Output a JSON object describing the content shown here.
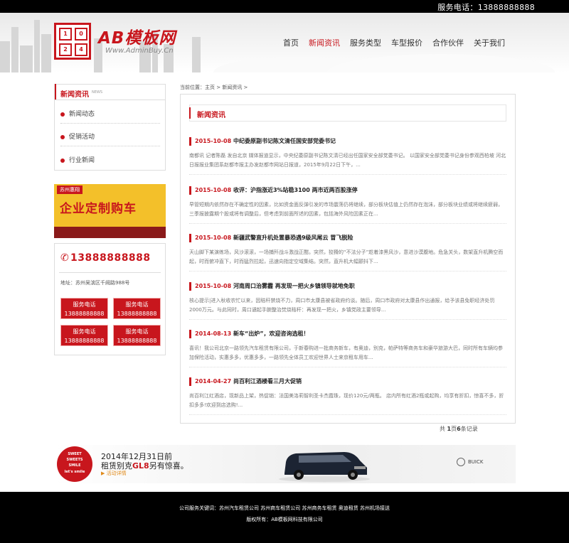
{
  "topbar": {
    "phone": "服务电话：13888888888"
  },
  "header": {
    "logo_cells": [
      "1",
      "0",
      "2",
      "4"
    ],
    "logo_title": "AB模板网",
    "logo_url": "Www.AdminBuy.Cn",
    "nav": [
      {
        "label": "首页",
        "active": false
      },
      {
        "label": "新闻资讯",
        "active": true
      },
      {
        "label": "服务类型",
        "active": false
      },
      {
        "label": "车型报价",
        "active": false
      },
      {
        "label": "合作伙伴",
        "active": false
      },
      {
        "label": "关于我们",
        "active": false
      }
    ]
  },
  "sidebar": {
    "title": "新闻资讯",
    "subtitle": "NEWS",
    "items": [
      "新闻动态",
      "促销活动",
      "行业新闻"
    ],
    "promo": {
      "tag": "苏州惠翔",
      "text": "企业定制购车"
    },
    "phone": "13888888888",
    "address": "地址：苏州吴滨区千阙路988号",
    "service_buttons": [
      {
        "label": "服务电话",
        "number": "13888888888"
      },
      {
        "label": "服务电话",
        "number": "13888888888"
      },
      {
        "label": "服务电话",
        "number": "13888888888"
      },
      {
        "label": "服务电话",
        "number": "13888888888"
      }
    ]
  },
  "breadcrumb": "当前位置：主页 > 新闻资讯 >",
  "main": {
    "title": "新闻资讯",
    "articles": [
      {
        "date": "2015-10-08",
        "title": "中纪委原副书记陈文清任国安部党委书记",
        "summary": "南都讯 记者陈磊 发自北京 媒体报道显示，中央纪委原副书记陈文清已经出任国家安全部党委书记。 以国家安全部党委书记身份参观西柏坡 河北日报报业集团系赵都市报主办发赵都市网站日报道，2015年9月22日下午，..."
      },
      {
        "date": "2015-10-08",
        "title": "收评：沪指涨近3%站稳3100 两市近两百股涨停",
        "summary": "早管短期内依然存在不确定性的因素，比如资金面反弹引发的市场震荡仍将继续，部分板块估值上仍然存在泡沫，部分板块业绩或将继续疲弱，三季报披露期个股或将有调整后，但考虑到前面所述的因素，包括海外风险因素正在..."
      },
      {
        "date": "2015-10-08",
        "title": "新疆武警直升机处置暴恐遇9级风尾云 冒飞脱险",
        "summary": "天山脚下某演练场，风沙滚滚，一场捕歼战斗激战正酣。突然，狡猾的“不法分子”趁着漆黑风沙，意进沙漠腹地。危急关头，数架直升机腾空而起，时而俯冲直下，时而猛烈拉起，迅速向指定空域集结。突然，直升机大幅颤抖下..."
      },
      {
        "date": "2015-10-08",
        "title": "河南周口治雾霾 再发现一把火乡镇领导就地免职",
        "summary": "核心提示|进入秋收农忙以来，因秸秆禁烧不力，周口市太康县被省政府约谈。随后，周口市政府对太康县作出通报，给予该县免职经济处罚2000万元。与此同时，周口谴起手腕整治焚烧秸秆：再发现一把火，乡镇党政主要领导..."
      },
      {
        "date": "2014-08-13",
        "title": "新车“出炉”，欢迎咨询选租！",
        "summary": "喜讯！我公司北京一路领先汽车租赁有限公司，于新春购进一批商务新车，有奥迪，别克，帕萨特等商务车和豪华旅游大巴，同时所有车辆均参加保险活动，实惠多多，优惠多多，一路领先全体员工欢迎世界人士来京租车用车..."
      },
      {
        "date": "2014-04-27",
        "title": "尚百利江酒楼看三月大促销",
        "summary": "尚百利江红酒店，现新品上架，热促销：法国美洛莉智利圣卡杰霞珠，现价120元/两瓶。 店内所有红酒2瓶或起购，均享有折扣，惊喜不多，折扣多多!欢迎到店选购!..."
      }
    ],
    "pager": {
      "prefix": "共",
      "pages": "1",
      "mid": "页",
      "count": "6",
      "suffix": "条记录"
    }
  },
  "banner": {
    "badge_lines": [
      "SWEET",
      "SWEETS",
      "SMILE",
      "let's smile"
    ],
    "line1": "2014年12月31日前",
    "line2_prefix": "租赁别克",
    "line2_highlight": "GL8",
    "line2_suffix": "另有惊喜。",
    "link": "▶ 活动详情",
    "brand": "BUICK"
  },
  "footer": {
    "keywords": "公司服务关键词：苏州汽车租赁公司 苏州商车租赁公司 苏州商务车租赁 奥迪租赁 苏州机场接送",
    "copyright": "版权所有：AB模板网科技有限公司"
  },
  "colors": {
    "accent": "#c8161d",
    "footer_bg": "#000000"
  }
}
